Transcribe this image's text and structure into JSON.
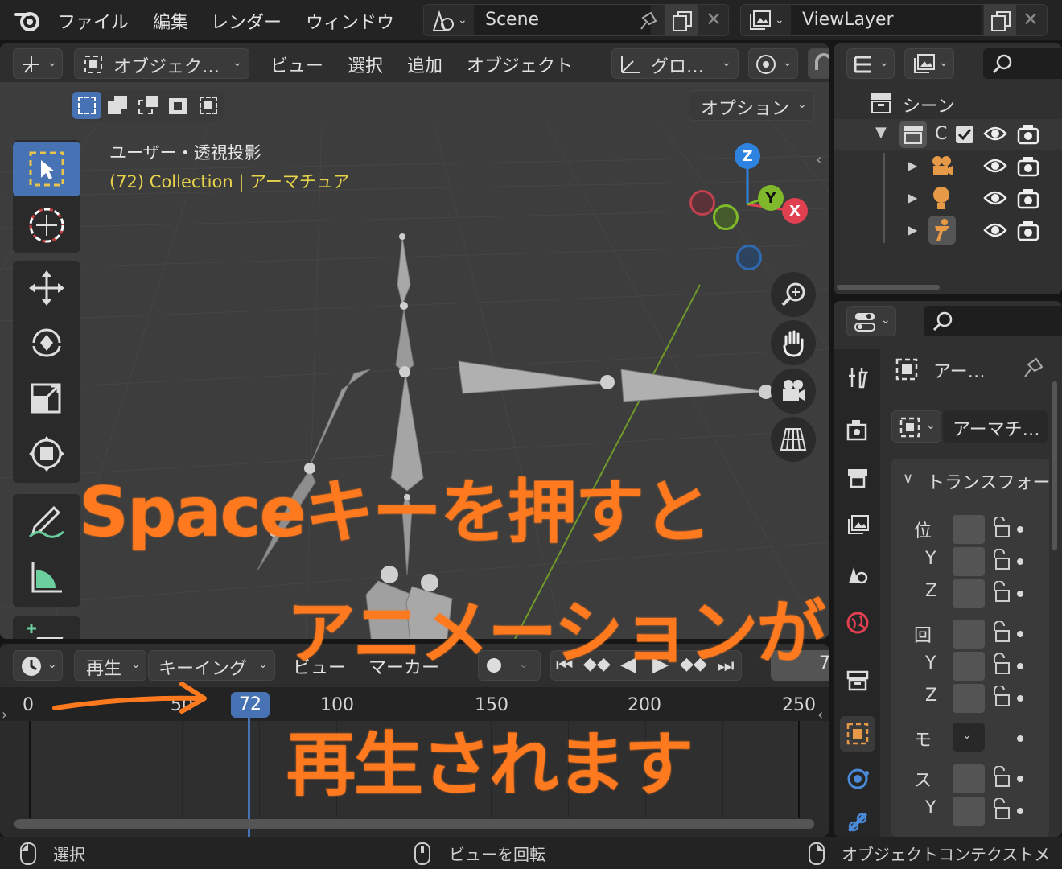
{
  "topbar": {
    "menus": [
      "ファイル",
      "編集",
      "レンダー",
      "ウィンドウ"
    ],
    "scene_name": "Scene",
    "view_layer_name": "ViewLayer"
  },
  "viewport_header": {
    "mode_label": "オブジェク…",
    "menus": [
      "ビュー",
      "選択",
      "追加",
      "オブジェクト"
    ],
    "transform_orientation": "グロ…",
    "options_label": "オプション"
  },
  "viewport": {
    "view_name": "ユーザー・透視投影",
    "context_info": "(72) Collection | アーマチュア",
    "gizmo": {
      "z": "Z",
      "y": "Y",
      "x": "X"
    }
  },
  "timeline": {
    "playback_label": "再生",
    "keying_label": "キーイング",
    "view_label": "ビュー",
    "marker_label": "マーカー",
    "current_frame": "72",
    "frame_field_partial": "7",
    "ticks": [
      "0",
      "50",
      "100",
      "150",
      "200",
      "250"
    ]
  },
  "outliner": {
    "scene_label": "シーン",
    "collection_label": "C"
  },
  "properties": {
    "object_name": "アー…",
    "object_data_name": "アーマチ…",
    "section_transform": "トランスフォー",
    "rows": [
      {
        "label": "位"
      },
      {
        "label": "Y"
      },
      {
        "label": "Z"
      },
      {
        "label": "回"
      },
      {
        "label": "Y"
      },
      {
        "label": "Z"
      },
      {
        "label": "モ"
      },
      {
        "label": "ス"
      },
      {
        "label": "Y"
      }
    ]
  },
  "statusbar": {
    "left": "選択",
    "middle": "ビューを回転",
    "right": "オブジェクトコンテクストメ"
  },
  "overlay_text": {
    "line1": "Spaceキーを押すと",
    "line2": "アニメーションが",
    "line3": "再生されます"
  },
  "colors": {
    "accent_orange": "#ff7a1f",
    "frame_blue": "#4772b3",
    "axis_x": "#e04050",
    "axis_y": "#7fb82a",
    "axis_z": "#2f83e0"
  }
}
